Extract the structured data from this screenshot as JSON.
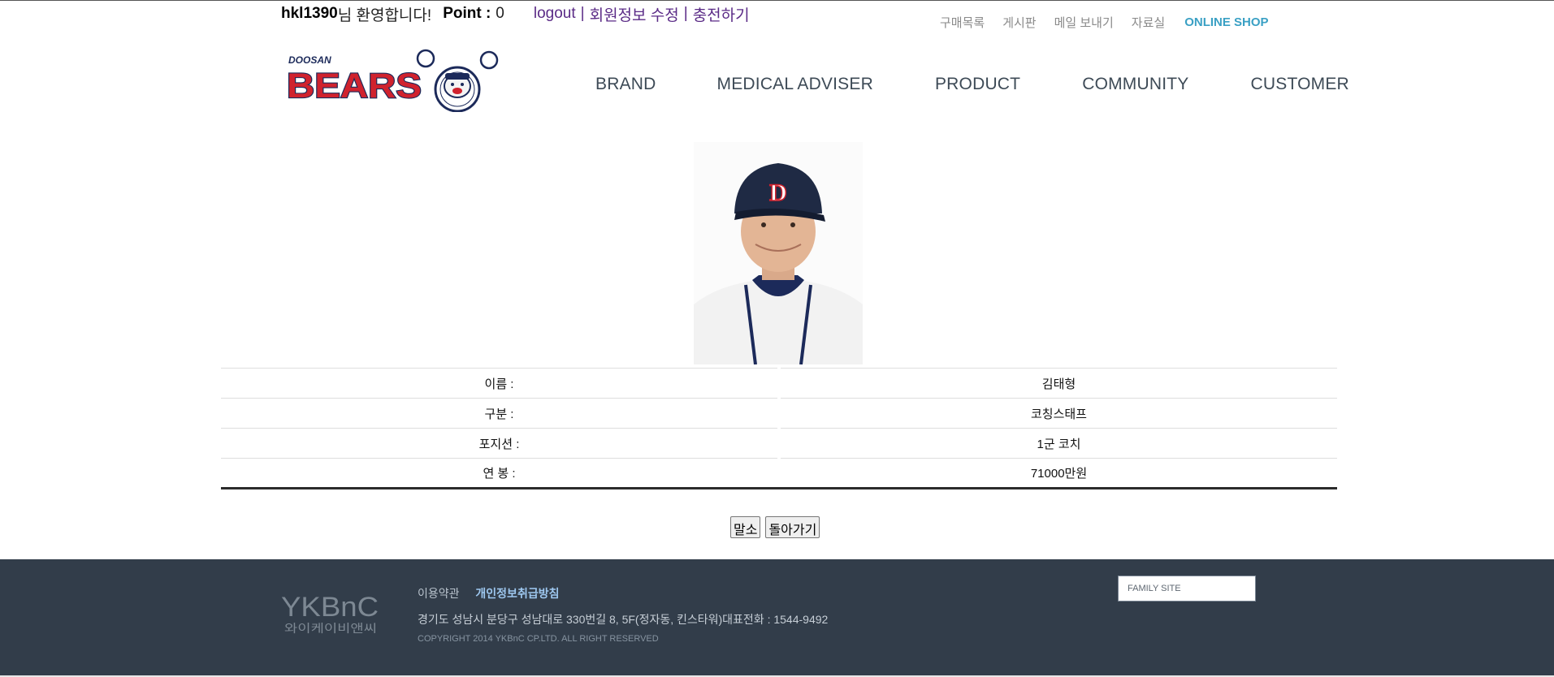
{
  "user_bar": {
    "user_id": "hkl1390",
    "welcome_text": "님 환영합니다!",
    "point_label": "Point :",
    "point_value": "0",
    "logout": "logout",
    "separator": "|",
    "edit_profile": "회원정보 수정",
    "charge": "충전하기"
  },
  "utility_menu": [
    "구매목록",
    "게시판",
    "메일 보내기",
    "자료실"
  ],
  "online_shop": "ONLINE SHOP",
  "logo": {
    "small_text": "DOOSAN",
    "big_text": "BEARS"
  },
  "main_nav": [
    "BRAND",
    "MEDICAL ADVISER",
    "PRODUCT",
    "COMMUNITY",
    "CUSTOMER"
  ],
  "player": {
    "cap_letter": "D",
    "rows": [
      {
        "label": "이름 :",
        "value": "김태형"
      },
      {
        "label": "구분 :",
        "value": "코칭스태프"
      },
      {
        "label": "포지션 :",
        "value": "1군 코치"
      },
      {
        "label": "연 봉 :",
        "value": "71000만원"
      }
    ]
  },
  "buttons": {
    "delete": "말소",
    "back": "돌아가기"
  },
  "footer": {
    "logo_top": "YKBnC",
    "logo_bottom": "와이케이비앤씨",
    "terms": "이용약관",
    "privacy": "개인정보취급방침",
    "address": "경기도 성남시 분당구 성남대로 330번길 8, 5F(정자동, 킨스타워)대표전화 : 1544-9492",
    "copyright": "COPYRIGHT 2014 YKBnC CP.LTD. ALL RIGHT RESERVED",
    "family_site": "FAMILY SITE"
  },
  "colors": {
    "footer_bg": "#323d4a",
    "online_shop": "#3aa0c4",
    "link_purple": "#5a2a86",
    "bears_red": "#d0222e",
    "bears_navy": "#1c2a5a"
  }
}
